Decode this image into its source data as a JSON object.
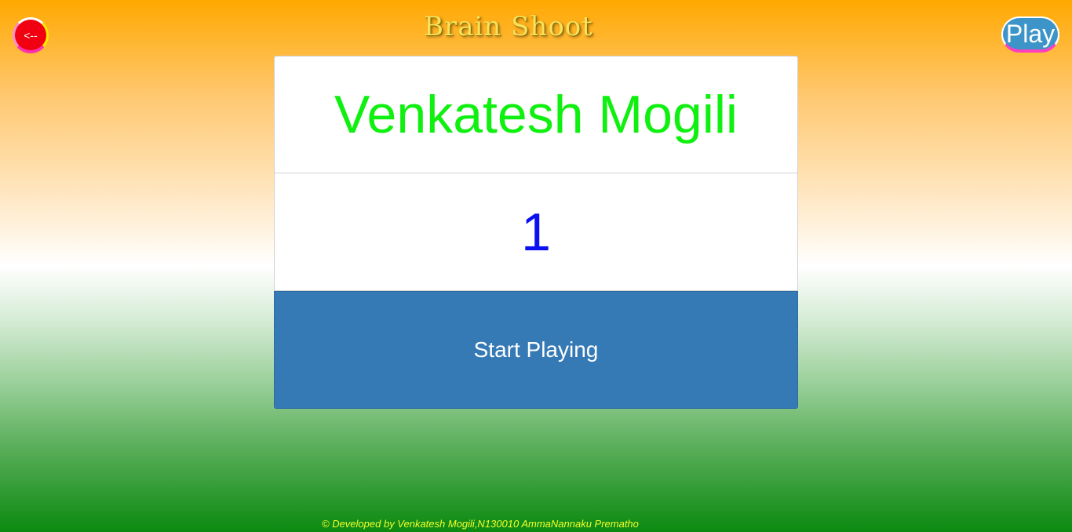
{
  "header": {
    "back_label": "<--",
    "title": "Brain Shoot",
    "play_label": "Play"
  },
  "main": {
    "player_name": "Venkatesh Mogili",
    "level": "1",
    "start_label": "Start Playing"
  },
  "footer": {
    "text": "© Developed by Venkatesh Mogili,N130010 AmmaNannaku Prematho"
  },
  "colors": {
    "name_text": "#10f010",
    "level_text": "#0a10f0",
    "start_button_bg": "#3579b5",
    "back_button_bg": "#f00010",
    "play_button_bg": "#3c94c8",
    "title_text": "#f6e35a",
    "footer_text": "#f2ff2a"
  }
}
